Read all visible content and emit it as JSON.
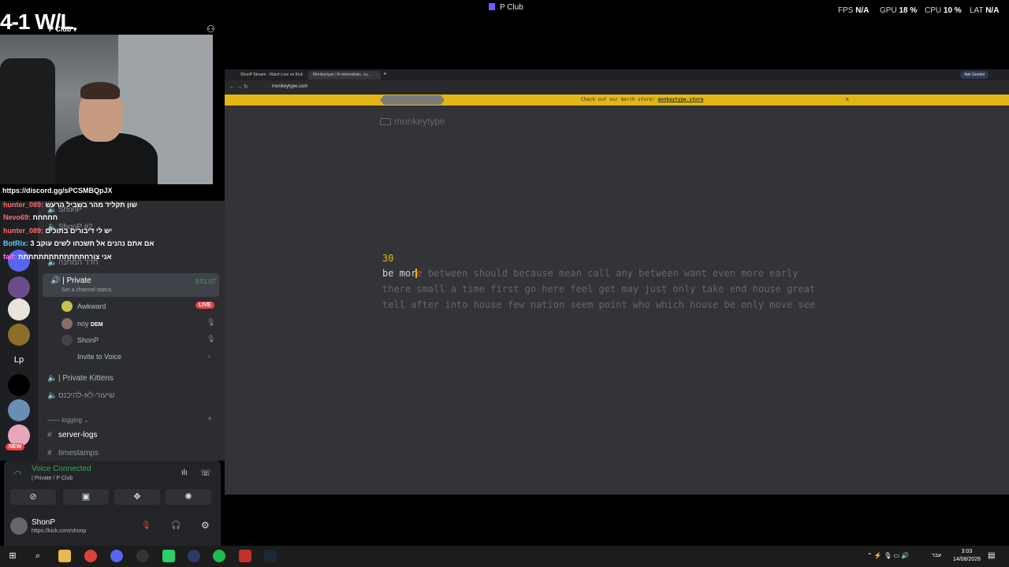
{
  "topbar": {
    "app_title": "P Club",
    "fps_label": "FPS",
    "fps_value": "N/A",
    "gpu_label": "GPU",
    "gpu_value": "18 %",
    "cpu_label": "CPU",
    "cpu_value": "10 %",
    "lat_label": "LAT",
    "lat_value": "N/A"
  },
  "stream": {
    "record": "4-1 W/L",
    "discord_link": "https://discord.gg/sPCSMBQpJX"
  },
  "chat": [
    {
      "user": "hunter_089:",
      "text": "שון תקליד מהר בשביל הרעש"
    },
    {
      "user": "Nevo69:",
      "text": "חחחחח"
    },
    {
      "user": "hunter_089:",
      "text": "יש לי דיבורים בתוכים"
    },
    {
      "user": "BotRix:",
      "text": "3 אם אתם נהנים אל תשכחו לשים עוקב "
    },
    {
      "user": "faif:",
      "text": "אני צורחתתתתתתתתתתתתת"
    }
  ],
  "discord": {
    "server_name": "P Club",
    "channels_top": [
      "ShonP",
      "ShonP #2",
      "חדר המתנה"
    ],
    "private_channel": {
      "name": "| Private",
      "status": "Set a channel status",
      "timer": "3:51:07"
    },
    "members": [
      {
        "name": "Awkward",
        "badge": "LIVE"
      },
      {
        "name": "noy",
        "tag": "DEM"
      },
      {
        "name": "ShonP"
      }
    ],
    "invite_label": "Invite to Voice",
    "channels_bottom": [
      "| Private Kittens",
      "שיעור-לא-להיכנס"
    ],
    "category": "logging",
    "text_channels": [
      "server-logs",
      "timestamps"
    ],
    "voice_connected": "Voice Connected",
    "voice_location": "| Private / P Club",
    "user": {
      "name": "ShonP",
      "subtitle": "https://kick.com/shonp"
    },
    "new_badge": "NEW",
    "lp_label": "Lp"
  },
  "browser": {
    "tabs": [
      "ShonP Stream - Watch Live on Kick",
      "Monkeytype | A minimalistic, cu..."
    ],
    "ask_gemini": "Ask Gemini",
    "url": "monkeytype.com",
    "banner_text": "Check out our merch store!",
    "banner_link": "monkeytype.store"
  },
  "monkeytype": {
    "logo": "monkeytype",
    "timer": "30",
    "typed": "be mor",
    "error_char": "e",
    "line1_rest": " between should because mean call any between want even more early",
    "line2": "there small a time first go here feel get may just only take end house great",
    "line3": "tell after into house few nation seem point who which house be only move see"
  },
  "taskbar": {
    "lang": "עבר",
    "time": "3:03",
    "date": "14/08/2026"
  }
}
